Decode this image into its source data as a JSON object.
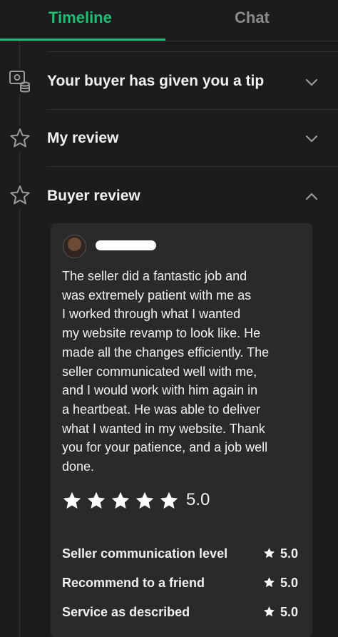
{
  "colors": {
    "accent": "#1dbf73",
    "background": "#1c1c1e",
    "card": "#2a2a2d"
  },
  "tabs": [
    {
      "label": "Timeline",
      "active": true
    },
    {
      "label": "Chat",
      "active": false
    }
  ],
  "timeline": {
    "items": [
      {
        "label": "Your buyer has given you a tip",
        "icon": "tip-coins-icon",
        "expanded": false
      },
      {
        "label": "My review",
        "icon": "star-outline-icon",
        "expanded": false
      },
      {
        "label": "Buyer review",
        "icon": "star-outline-icon",
        "expanded": true
      }
    ]
  },
  "buyer_review": {
    "reviewer_avatar": "avatar",
    "reviewer_name_redacted": true,
    "lines": [
      "The seller did a fantastic job and",
      "was extremely patient with me as",
      "I worked through what I wanted",
      "my website revamp to look like. He",
      "made all the changes efficiently. The",
      "seller communicated well with me,",
      "and I would work with him again in",
      "a heartbeat. He was able to deliver",
      "what I wanted in my website. Thank",
      "you for your patience, and a job well",
      "done."
    ],
    "star_count": 5,
    "overall_rating": "5.0",
    "criteria": [
      {
        "label": "Seller communication level",
        "rating": "5.0"
      },
      {
        "label": "Recommend to a friend",
        "rating": "5.0"
      },
      {
        "label": "Service as described",
        "rating": "5.0"
      }
    ]
  }
}
